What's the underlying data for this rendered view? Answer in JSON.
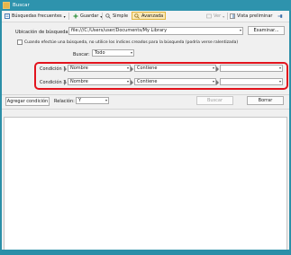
{
  "window": {
    "title": "Buscar"
  },
  "toolbar": {
    "frequent_label": "Búsquedas frecuentes",
    "save_label": "Guardar",
    "simple_label": "Simple",
    "advanced_label": "Avanzada",
    "view_label": "Ver",
    "preview_label": "Vista preliminar"
  },
  "location": {
    "label": "Ubicación de búsqueda:",
    "value": "file:///C:/Users/user/Documents/My Library",
    "browse_label": "Examinar..."
  },
  "index_option": {
    "label": "Cuando efectúe una búsqueda, no utilice los índices creados para la búsqueda (podría verse ralentizada)",
    "checked": false
  },
  "search_in": {
    "label": "Buscar:",
    "value": "Todo"
  },
  "conditions": [
    {
      "label": "Condición 1",
      "field": "Nombre",
      "operator": "Contiene",
      "value": ""
    },
    {
      "label": "Condición 2",
      "field": "Nombre",
      "operator": "Contiene",
      "value": ""
    }
  ],
  "actions": {
    "add_condition_label": "Agregar condición",
    "relation_label": "Relación:",
    "relation_value": "Y",
    "search_label": "Buscar",
    "clear_label": "Borrar"
  },
  "colors": {
    "titlebar": "#2e93ad",
    "highlight_border": "#e2141d",
    "active_tab": "#fbe9b7"
  }
}
